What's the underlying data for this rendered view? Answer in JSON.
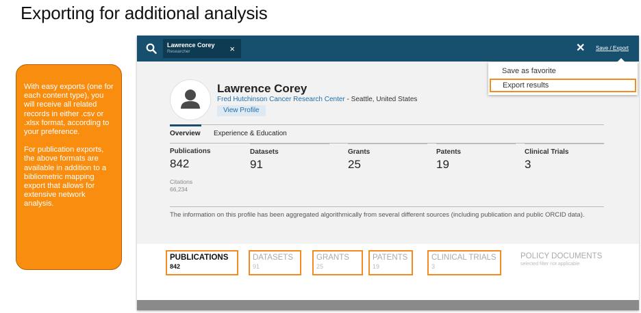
{
  "slide": {
    "title": "Exporting for additional analysis",
    "callout_p1": "With easy exports (one for each content type), you will receive all related records in either .csv or .xlsx format, according to your preference.",
    "callout_p2": "For publication exports, the above formats are available in addition to a bibliometric mapping export that allows for extensive network analysis."
  },
  "topbar": {
    "search_icon": "search-icon",
    "chip_name": "Lawrence Corey",
    "chip_role": "Researcher",
    "chip_close": "×",
    "close": "✕",
    "save_export": "Save / Export"
  },
  "dropdown": {
    "items": [
      "Save as favorite",
      "Export results"
    ]
  },
  "profile": {
    "name": "Lawrence Corey",
    "institution": "Fred Hutchinson Cancer Research Center",
    "location": " - Seattle, United States",
    "view_profile": "View Profile"
  },
  "tabs": [
    "Overview",
    "Experience & Education"
  ],
  "stats": [
    {
      "label": "Publications",
      "value": "842"
    },
    {
      "label": "Datasets",
      "value": "91"
    },
    {
      "label": "Grants",
      "value": "25"
    },
    {
      "label": "Patents",
      "value": "19"
    },
    {
      "label": "Clinical Trials",
      "value": "3"
    }
  ],
  "citations": {
    "label": "Citations",
    "value": "66,234"
  },
  "info_text": "The information on this profile has been aggregated algorithmically from several different sources (including publication and public ORCID data).",
  "bottom_tabs": [
    {
      "label": "PUBLICATIONS",
      "count": "842"
    },
    {
      "label": "DATASETS",
      "count": "91"
    },
    {
      "label": "GRANTS",
      "count": "25"
    },
    {
      "label": "PATENTS",
      "count": "19"
    },
    {
      "label": "CLINICAL TRIALS",
      "count": "3"
    },
    {
      "label": "POLICY DOCUMENTS",
      "note": "selected filter not applicable"
    }
  ],
  "colors": {
    "topbar": "#17506f",
    "highlight": "#f58a1f",
    "callout": "#f98d10",
    "link": "#1f6fae"
  }
}
